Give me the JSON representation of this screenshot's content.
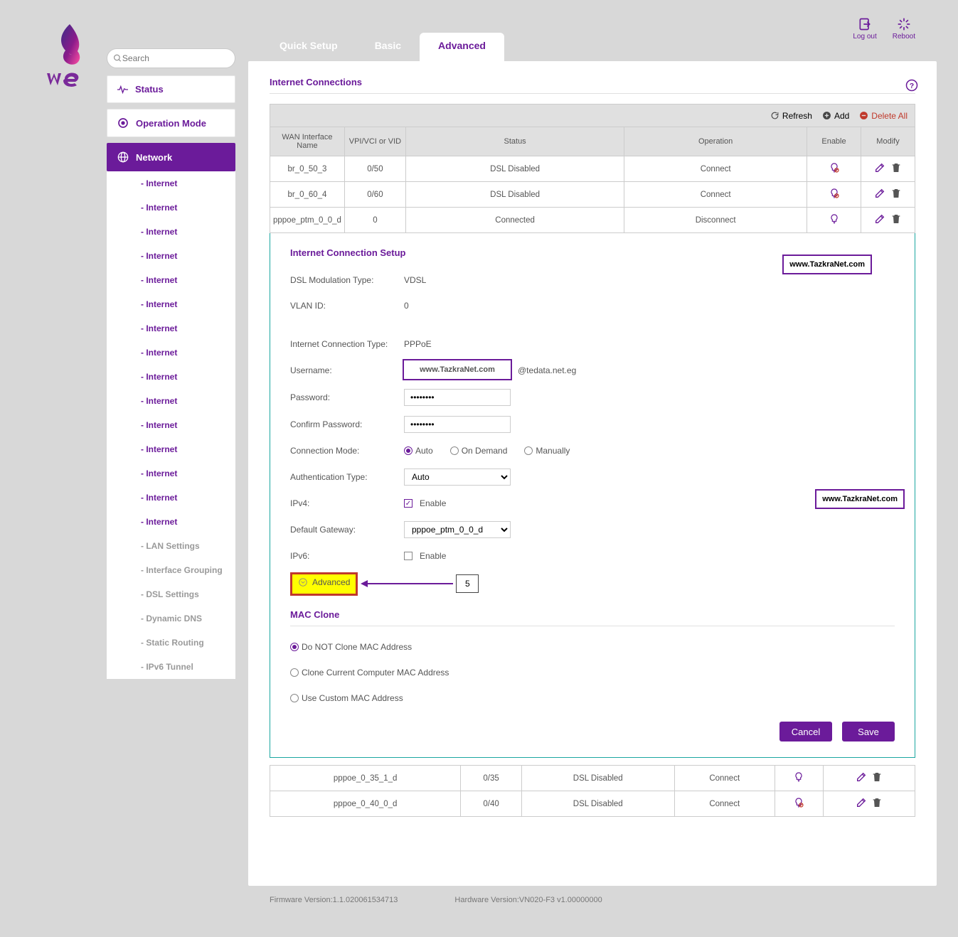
{
  "brand": "we",
  "search": {
    "placeholder": "Search"
  },
  "sidebar": {
    "status": "Status",
    "opmode": "Operation Mode",
    "network": "Network",
    "internet_label": "- Internet",
    "lan": "- LAN Settings",
    "ifgrp": "- Interface Grouping",
    "dsl": "- DSL Settings",
    "ddns": "- Dynamic DNS",
    "sroute": "- Static Routing",
    "ipv6t": "- IPv6 Tunnel"
  },
  "tabs": {
    "quick": "Quick Setup",
    "basic": "Basic",
    "advanced": "Advanced"
  },
  "top": {
    "logout": "Log out",
    "reboot": "Reboot"
  },
  "title": "Internet Connections",
  "toolbar": {
    "refresh": "Refresh",
    "add": "Add",
    "delall": "Delete All"
  },
  "th": {
    "name": "WAN Interface Name",
    "vpi": "VPI/VCI or VID",
    "status": "Status",
    "op": "Operation",
    "enable": "Enable",
    "modify": "Modify"
  },
  "rows": [
    {
      "name": "br_0_50_3",
      "vpi": "0/50",
      "status": "DSL Disabled",
      "op": "Connect",
      "opclass": "op-connect",
      "bulb_off": true
    },
    {
      "name": "br_0_60_4",
      "vpi": "0/60",
      "status": "DSL Disabled",
      "op": "Connect",
      "opclass": "op-connect",
      "bulb_off": true
    },
    {
      "name": "pppoe_ptm_0_0_d",
      "vpi": "0",
      "status": "Connected",
      "op": "Disconnect",
      "opclass": "op-disconnect",
      "bulb_off": false
    }
  ],
  "rows_after": [
    {
      "name": "pppoe_0_35_1_d",
      "vpi": "0/35",
      "status": "DSL Disabled",
      "op": "Connect",
      "opclass": "op-connect",
      "bulb_off": false
    },
    {
      "name": "pppoe_0_40_0_d",
      "vpi": "0/40",
      "status": "DSL Disabled",
      "op": "Connect",
      "opclass": "op-connect",
      "bulb_off": true
    }
  ],
  "form": {
    "title": "Internet Connection Setup",
    "dsl_type_lbl": "DSL Modulation Type:",
    "dsl_type_val": "VDSL",
    "vlan_lbl": "VLAN ID:",
    "vlan_val": "0",
    "conn_type_lbl": "Internet Connection Type:",
    "conn_type_val": "PPPoE",
    "user_lbl": "Username:",
    "user_suffix": "@tedata.net.eg",
    "pass_lbl": "Password:",
    "pass_val": "••••••••",
    "cpass_lbl": "Confirm Password:",
    "cpass_val": "••••••••",
    "mode_lbl": "Connection Mode:",
    "mode_auto": "Auto",
    "mode_ondemand": "On Demand",
    "mode_manual": "Manually",
    "auth_lbl": "Authentication Type:",
    "auth_val": "Auto",
    "ipv4_lbl": "IPv4:",
    "ipv4_enable": "Enable",
    "gw_lbl": "Default Gateway:",
    "gw_val": "pppoe_ptm_0_0_d",
    "ipv6_lbl": "IPv6:",
    "ipv6_enable": "Enable",
    "adv": "Advanced",
    "mac_title": "MAC Clone",
    "mac1": "Do NOT Clone MAC Address",
    "mac2": "Clone Current Computer MAC Address",
    "mac3": "Use Custom MAC Address",
    "cancel": "Cancel",
    "save": "Save",
    "annot": "www.TazkraNet.com",
    "annot_num": "5"
  },
  "footer": {
    "fw_lbl": "Firmware Version:",
    "fw_val": "1.1.020061534713",
    "hw_lbl": "Hardware Version:",
    "hw_val": "VN020-F3 v1.00000000"
  }
}
